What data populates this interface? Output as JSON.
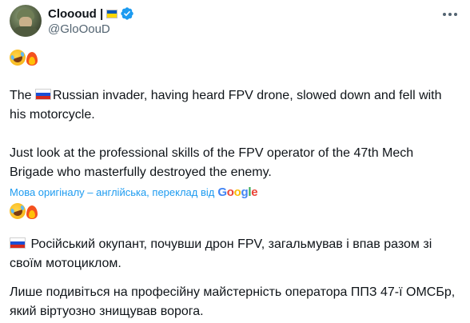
{
  "author": {
    "display_name": "Cloooud |",
    "handle": "@GloOouD",
    "flag_colors": [
      "#0057b7",
      "#ffd700"
    ],
    "verified_icon": "verified-badge-icon",
    "verified_color": "#1d9bf0"
  },
  "post": {
    "emoji_line": [
      "rolling-on-floor-laughing-emoji",
      "fire-emoji"
    ],
    "paragraph1": "Russian invader, having heard FPV drone, slowed down and fell with his motorcycle.",
    "paragraph1_prefix": "The ",
    "paragraph2": "Just look at the professional skills of the FPV operator of the 47th Mech Brigade who masterfully destroyed the enemy."
  },
  "translation": {
    "label": "Мова оригіналу – англійська, переклад від",
    "provider": "Google",
    "link_color": "#1d9bf0"
  },
  "translated_post": {
    "emoji_line": [
      "rolling-on-floor-laughing-emoji",
      "fire-emoji"
    ],
    "paragraph1": "Російський окупант, почувши дрон FPV, загальмував і впав разом зі своїм мотоциклом.",
    "paragraph2": "Лише подивіться на професійну майстерність оператора ППЗ 47-ї ОМСБр, який віртуозно знищував ворога."
  },
  "colors": {
    "text": "#0f1419",
    "secondary": "#536471"
  }
}
